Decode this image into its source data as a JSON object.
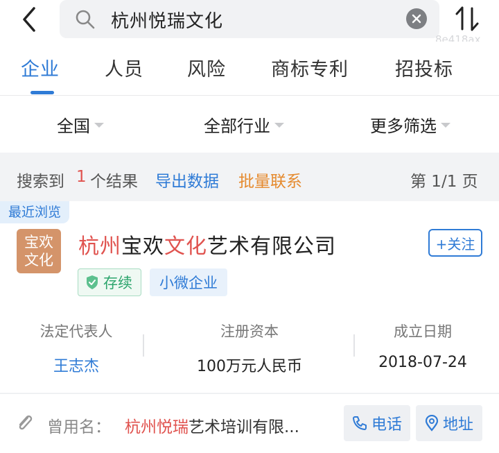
{
  "search": {
    "query": "杭州悦瑞文化"
  },
  "watermark": "8e418ax",
  "tabs": [
    {
      "label": "企业",
      "active": true
    },
    {
      "label": "人员",
      "active": false
    },
    {
      "label": "风险",
      "active": false
    },
    {
      "label": "商标专利",
      "active": false
    },
    {
      "label": "招投标",
      "active": false
    }
  ],
  "filters": [
    {
      "label": "全国"
    },
    {
      "label": "全部行业"
    },
    {
      "label": "更多筛选"
    }
  ],
  "results": {
    "prefix": "搜索到",
    "count": "1",
    "suffix": "个结果",
    "export_label": "导出数据",
    "batch_contact_label": "批量联系",
    "page_label": "第 1/1 页"
  },
  "company": {
    "recent_badge": "最近浏览",
    "logo_line1": "宝欢",
    "logo_line2": "文化",
    "name_parts": [
      "杭州",
      "宝欢",
      "文化",
      "艺术有限公司"
    ],
    "follow_label": "+关注",
    "status_tag": "存续",
    "size_tag": "小微企业",
    "legal_rep_label": "法定代表人",
    "legal_rep_value": "王志杰",
    "capital_label": "注册资本",
    "capital_value": "100万元人民币",
    "founded_label": "成立日期",
    "founded_value": "2018-07-24"
  },
  "former_name": {
    "label": "曾用名：",
    "highlight": "杭州悦瑞",
    "rest": "艺术培训有限...",
    "phone_label": "电话",
    "address_label": "地址"
  },
  "colors": {
    "accent": "#2f7bd6",
    "highlight": "#e0534f",
    "batch": "#e58a2e",
    "status_green": "#2da56d",
    "logo_bg": "#d4946a"
  }
}
